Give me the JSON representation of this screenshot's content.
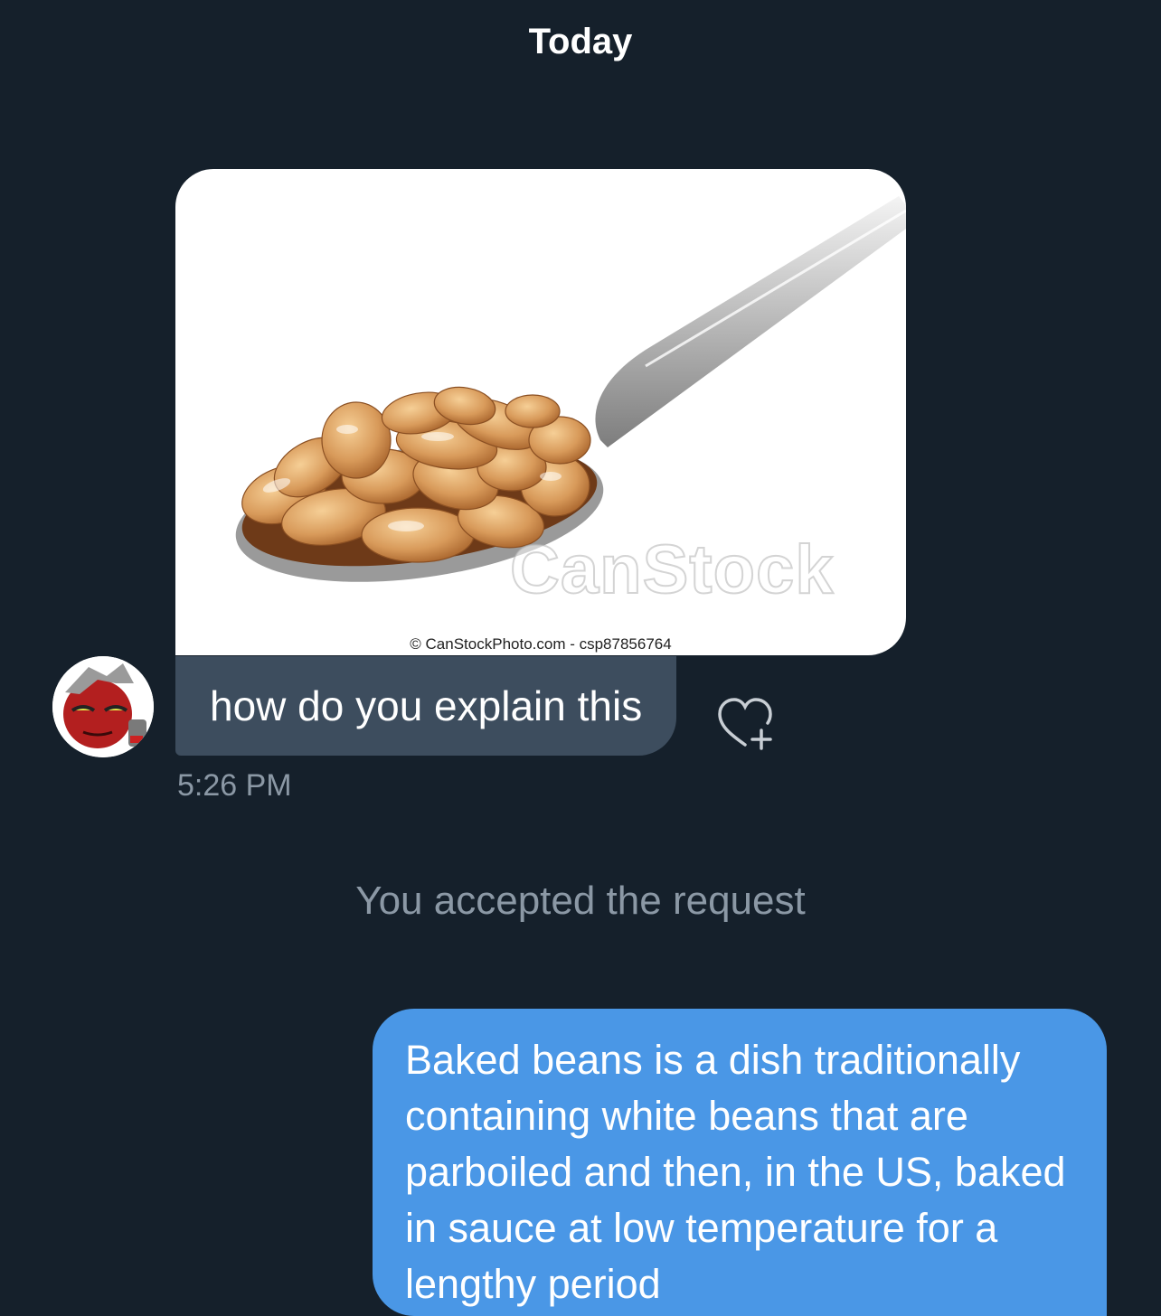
{
  "conversation": {
    "day_separator": "Today",
    "incoming": {
      "image": {
        "watermark": "CanStock",
        "credit": "© CanStockPhoto.com - csp87856764"
      },
      "text": "how do you explain this",
      "time": "5:26 PM",
      "react_icon": "heart-plus-icon"
    },
    "system_notice": "You accepted the request",
    "outgoing": {
      "text": "Baked beans is a dish traditionally containing white beans that are parboiled and then, in the US, baked in sauce at low temperature for a lengthy period"
    }
  },
  "colors": {
    "background": "#15202b",
    "incoming_bubble": "#3d4d5e",
    "outgoing_bubble": "#4a97e6",
    "secondary_text": "#8b98a5"
  }
}
